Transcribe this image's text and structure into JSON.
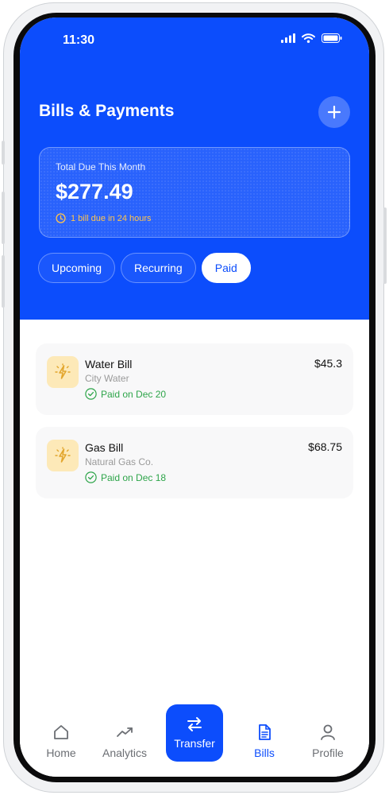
{
  "status_bar": {
    "time": "11:30"
  },
  "header": {
    "title": "Bills & Payments"
  },
  "summary": {
    "label": "Total Due This Month",
    "amount": "$277.49",
    "note": "1 bill due in 24 hours"
  },
  "tabs": [
    {
      "label": "Upcoming",
      "active": false
    },
    {
      "label": "Recurring",
      "active": false
    },
    {
      "label": "Paid",
      "active": true
    }
  ],
  "bills": [
    {
      "name": "Water Bill",
      "provider": "City Water",
      "status": "Paid on Dec 20",
      "amount": "$45.3",
      "icon": "lightning-icon"
    },
    {
      "name": "Gas Bill",
      "provider": "Natural Gas Co.",
      "status": "Paid on Dec 18",
      "amount": "$68.75",
      "icon": "lightning-icon"
    }
  ],
  "nav": {
    "items": [
      {
        "label": "Home",
        "icon": "home-icon"
      },
      {
        "label": "Analytics",
        "icon": "trend-icon"
      },
      {
        "label": "Transfer",
        "icon": "swap-icon"
      },
      {
        "label": "Bills",
        "icon": "document-icon"
      },
      {
        "label": "Profile",
        "icon": "user-icon"
      }
    ],
    "active": "Bills"
  },
  "colors": {
    "brand": "#0c4dfc",
    "success": "#2ea54a",
    "warning": "#ffc44d"
  }
}
